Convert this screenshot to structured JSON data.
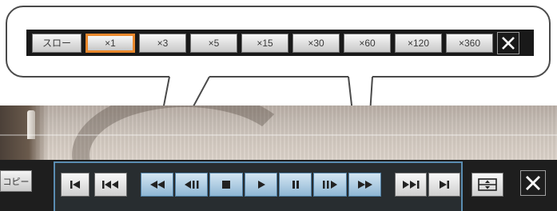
{
  "speed_bar": {
    "slow_label": "スロー",
    "speeds": [
      "×1",
      "×3",
      "×5",
      "×15",
      "×30",
      "×60",
      "×120",
      "×360"
    ],
    "selected_speed": "×1"
  },
  "control_bar": {
    "copy_label": "コピー",
    "buttons": [
      "skip-to-start",
      "previous-record",
      "fast-rewind",
      "step-back",
      "stop",
      "play",
      "pause",
      "step-forward",
      "fast-forward",
      "next-record",
      "skip-to-end"
    ],
    "highlighted": [
      "fast-rewind",
      "step-back",
      "stop",
      "play",
      "pause",
      "step-forward",
      "fast-forward"
    ]
  },
  "colors": {
    "selected_border": "#e9882c",
    "highlight_frame": "#5a8db2",
    "bar_background": "#1e1e1e"
  }
}
